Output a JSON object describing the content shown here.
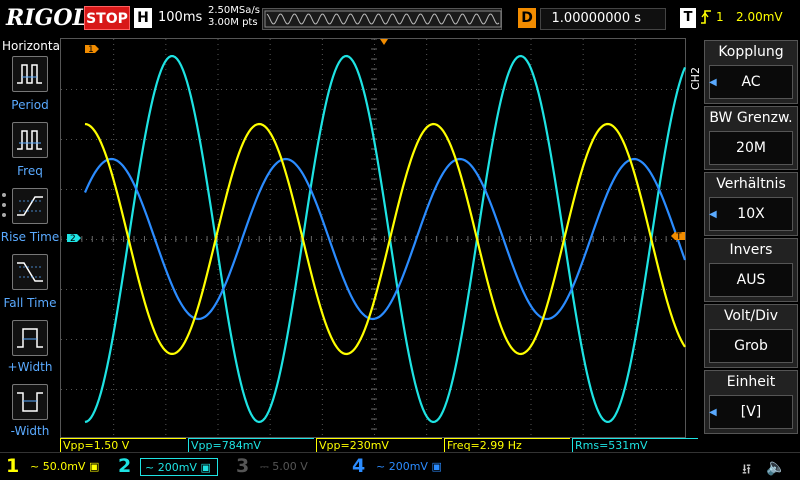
{
  "header": {
    "logo": "RIGOL",
    "run_state": "STOP",
    "h_badge": "H",
    "timebase": "100ms",
    "sample_rate": "2.50MSa/s",
    "memory_depth": "3.00M pts",
    "d_badge": "D",
    "delay": "1.00000000 s",
    "t_badge": "T",
    "trigger_channel": "1",
    "trigger_level": "2.00mV"
  },
  "left_menu": {
    "title": "Horizontal",
    "items": [
      {
        "label": "Period"
      },
      {
        "label": "Freq"
      },
      {
        "label": "Rise Time"
      },
      {
        "label": "Fall Time"
      },
      {
        "label": "+Width"
      },
      {
        "label": "-Width"
      }
    ]
  },
  "right_menu": {
    "channel": "CH2",
    "items": [
      {
        "title": "Kopplung",
        "value": "AC",
        "arrow": true
      },
      {
        "title": "BW Grenzw.",
        "value": "20M",
        "arrow": false
      },
      {
        "title": "Verhältnis",
        "value": "10X",
        "arrow": true
      },
      {
        "title": "Invers",
        "value": "AUS",
        "arrow": false
      },
      {
        "title": "Volt/Div",
        "value": "Grob",
        "arrow": false
      },
      {
        "title": "Einheit",
        "value": "[V]",
        "arrow": true
      }
    ]
  },
  "markers": {
    "ch1_marker": "1",
    "ch2_marker": "2",
    "trigger_marker": "T"
  },
  "measurements": [
    {
      "text": "Vpp=1.50 V",
      "color": "#ffff00"
    },
    {
      "text": "Vpp=784mV",
      "color": "#1ee3e3"
    },
    {
      "text": "Vpp=230mV",
      "color": "#ffff00"
    },
    {
      "text": "Freq=2.99 Hz",
      "color": "#ffff00"
    },
    {
      "text": "Rms=531mV",
      "color": "#1ee3e3"
    }
  ],
  "channels": [
    {
      "num": "1",
      "scale": "50.0mV",
      "color": "#ffff00",
      "selected": false
    },
    {
      "num": "2",
      "scale": "200mV",
      "color": "#1ee3e3",
      "selected": true
    },
    {
      "num": "3",
      "scale": "5.00 V",
      "color": "#555555",
      "selected": false
    },
    {
      "num": "4",
      "scale": "200mV",
      "color": "#2b8cff",
      "selected": false
    }
  ],
  "colors": {
    "ch1": "#ffff00",
    "ch2": "#1ee3e3",
    "ch4": "#2b8cff",
    "trigger": "#f28c00",
    "stop": "#d81818"
  },
  "waveforms": {
    "period_divisions": 3.34,
    "ch1": {
      "amplitude_div": 2.3,
      "phase": 1.5708
    },
    "ch2": {
      "amplitude_div": 3.66,
      "phase": -1.5708
    },
    "ch4": {
      "amplitude_div": 1.6,
      "phase": 0.62
    }
  }
}
